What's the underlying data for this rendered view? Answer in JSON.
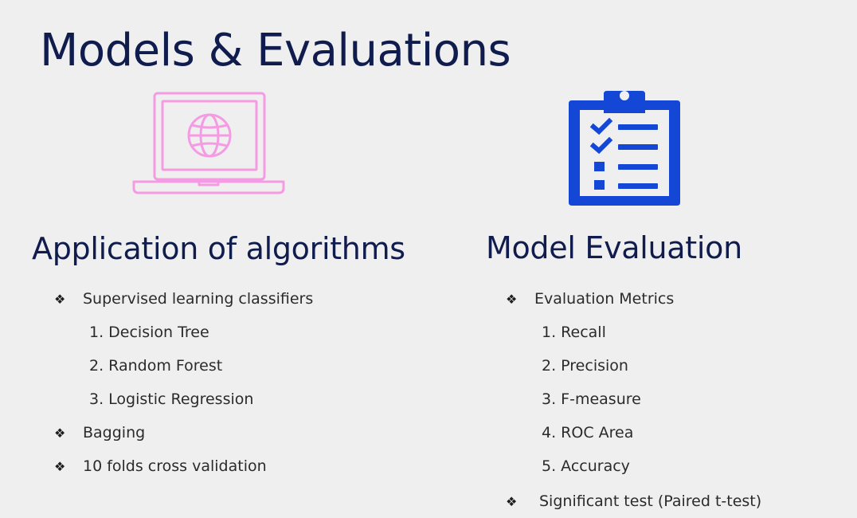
{
  "title": "Models & Evaluations",
  "colors": {
    "title": "#0f1c4d",
    "laptop_icon": "#f59be3",
    "clipboard_icon": "#1547d6",
    "background": "#efefef"
  },
  "left": {
    "icon": "laptop-globe-icon",
    "heading": "Application of algorithms",
    "bullets": [
      {
        "marker": "❖",
        "text": "Supervised learning classifiers"
      },
      {
        "marker": "❖",
        "text": "Bagging"
      },
      {
        "marker": "❖",
        "text": "10 folds cross validation"
      }
    ],
    "sub_items": [
      "1. Decision Tree",
      "2. Random Forest",
      "3. Logistic Regression"
    ]
  },
  "right": {
    "icon": "clipboard-checklist-icon",
    "heading": "Model Evaluation",
    "bullets": [
      {
        "marker": "❖",
        "text": "Evaluation Metrics"
      },
      {
        "marker": "❖",
        "text": "Significant test (Paired t-test)"
      }
    ],
    "sub_items": [
      "1. Recall",
      "2. Precision",
      "3. F-measure",
      "4. ROC Area",
      "5. Accuracy"
    ]
  }
}
